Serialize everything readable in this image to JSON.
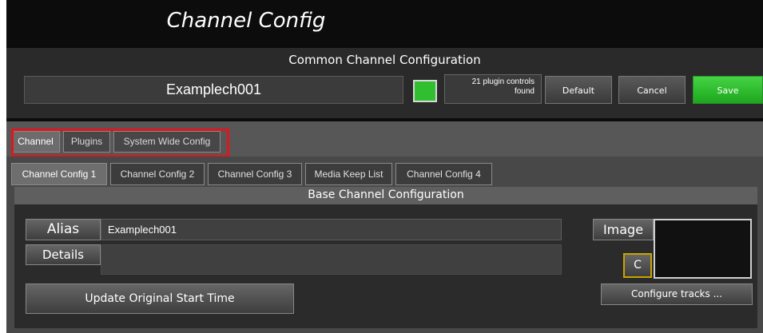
{
  "window": {
    "title": "Channel Config"
  },
  "common": {
    "title": "Common Channel Configuration",
    "channel_name": "Examplech001",
    "swatch_color": "#2fbf2f",
    "plugins_found_line1": "21 plugin controls",
    "plugins_found_line2": "found",
    "default_label": "Default",
    "cancel_label": "Cancel",
    "save_label": "Save"
  },
  "main_tabs": [
    {
      "label": "Channel",
      "active": true
    },
    {
      "label": "Plugins",
      "active": false
    },
    {
      "label": "System Wide Config",
      "active": false
    }
  ],
  "sub_tabs": [
    {
      "label": "Channel Config 1",
      "active": true
    },
    {
      "label": "Channel Config 2",
      "active": false
    },
    {
      "label": "Channel Config 3",
      "active": false
    },
    {
      "label": "Media Keep List",
      "active": false
    },
    {
      "label": "Channel Config 4",
      "active": false
    }
  ],
  "base": {
    "title": "Base Channel Configuration",
    "alias_label": "Alias",
    "alias_value": "Examplech001",
    "details_label": "Details",
    "details_value": "",
    "update_start_label": "Update Original Start Time",
    "image_label": "Image",
    "c_label": "C",
    "configure_tracks_label": "Configure tracks ..."
  },
  "highlight_color": "#e0161e"
}
